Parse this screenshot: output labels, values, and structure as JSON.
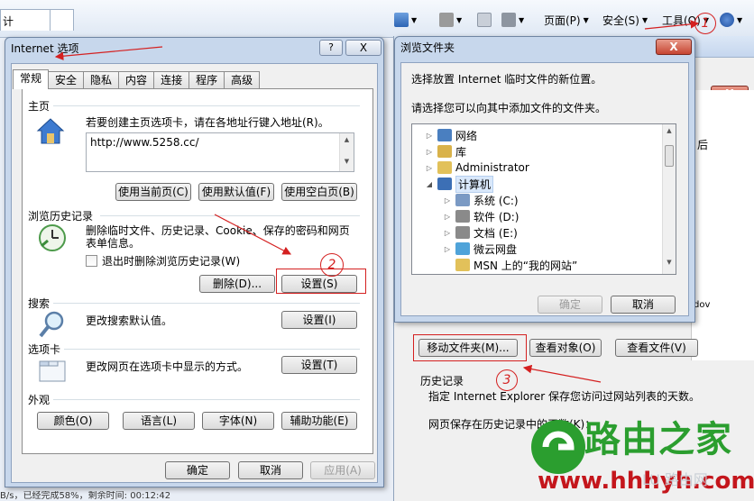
{
  "toolbar": {
    "tab_stub": "计",
    "page_menu": "页面(P)",
    "safety_menu": "安全(S)",
    "tools_menu": "工具(O)",
    "mark1": "1"
  },
  "options_dialog": {
    "title": "Internet 选项",
    "help": "?",
    "close": "X",
    "tabs": [
      "常规",
      "安全",
      "隐私",
      "内容",
      "连接",
      "程序",
      "高级"
    ],
    "home": {
      "title": "主页",
      "desc": "若要创建主页选项卡，请在各地址行键入地址(R)。",
      "url": "http://www.5258.cc/",
      "btn_current": "使用当前页(C)",
      "btn_default": "使用默认值(F)",
      "btn_blank": "使用空白页(B)"
    },
    "history": {
      "title": "浏览历史记录",
      "desc1": "删除临时文件、历史记录、Cookie、保存的密码和网页",
      "desc2": "表单信息。",
      "checkbox": "退出时删除浏览历史记录(W)",
      "btn_delete": "删除(D)...",
      "btn_settings": "设置(S)",
      "mark2": "2"
    },
    "search": {
      "title": "搜索",
      "desc": "更改搜索默认值。",
      "btn_settings": "设置(I)"
    },
    "tabs_section": {
      "title": "选项卡",
      "desc": "更改网页在选项卡中显示的方式。",
      "btn_settings": "设置(T)"
    },
    "appearance": {
      "title": "外观",
      "btn_colors": "颜色(O)",
      "btn_languages": "语言(L)",
      "btn_fonts": "字体(N)",
      "btn_accessibility": "辅助功能(E)"
    },
    "footer": {
      "ok": "确定",
      "cancel": "取消",
      "apply": "应用(A)"
    }
  },
  "browse_dialog": {
    "title": "浏览文件夹",
    "close": "X",
    "line1": "选择放置 Internet 临时文件的新位置。",
    "line2": "请选择您可以向其中添加文件的文件夹。",
    "tree": [
      {
        "label": "网络",
        "expander": "▷",
        "icon": "network-icon",
        "color": "#4a7fc0"
      },
      {
        "label": "库",
        "expander": "▷",
        "icon": "library-icon",
        "color": "#d9b24a"
      },
      {
        "label": "Administrator",
        "expander": "▷",
        "icon": "user-folder-icon",
        "color": "#e2c15a"
      },
      {
        "label": "计算机",
        "expander": "◢",
        "icon": "computer-icon",
        "color": "#3c6fb5"
      },
      {
        "label": "系统 (C:)",
        "expander": "▷",
        "icon": "windows-drive-icon",
        "color": "#7b9ac4"
      },
      {
        "label": "软件 (D:)",
        "expander": "▷",
        "icon": "drive-icon",
        "color": "#8a8a8a"
      },
      {
        "label": "文档 (E:)",
        "expander": "▷",
        "icon": "drive-icon",
        "color": "#8a8a8a"
      },
      {
        "label": "微云网盘",
        "expander": "▷",
        "icon": "cloud-drive-icon",
        "color": "#4fa3d9"
      },
      {
        "label": "MSN 上的“我的网站”",
        "expander": "",
        "icon": "folder-icon",
        "color": "#e2c15a"
      }
    ],
    "ok": "确定",
    "cancel": "取消"
  },
  "bg_window": {
    "label_after": "后",
    "label_dov": "dov",
    "btn_move": "移动文件夹(M)...",
    "btn_view_objects": "查看对象(O)",
    "btn_view_files": "查看文件(V)",
    "mark3": "3",
    "history_title": "历史记录",
    "history_desc": "指定 Internet Explorer 保存您访问过网站列表的天数。",
    "history_days": "网页保存在历史记录中的天数(K)："
  },
  "status_bar": "B/s，已经完成58%，剩余时间: 00:12:42",
  "logo": {
    "name": "路由之家",
    "url": "www.hhhyh.com",
    "watermark": "LU 路由网"
  },
  "colors": {
    "annotation_red": "#d42020",
    "logo_green": "#2b9e2f",
    "logo_red": "#c4161c"
  }
}
